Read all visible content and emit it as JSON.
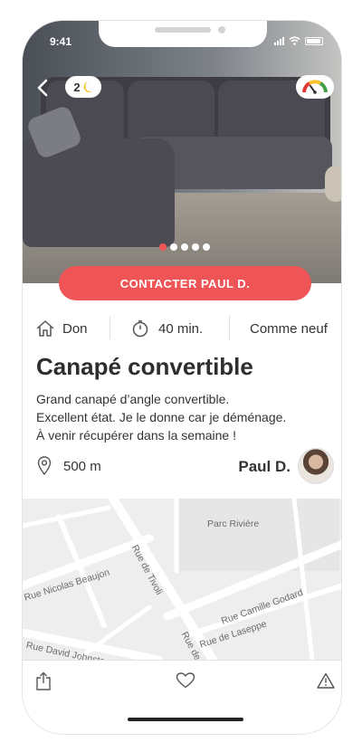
{
  "status_bar": {
    "time": "9:41"
  },
  "header": {
    "moon_count": "2"
  },
  "photo": {
    "slide_count": 5,
    "active_slide": 1
  },
  "contact_button": {
    "label": "CONTACTER PAUL D."
  },
  "info": {
    "type": "Don",
    "time": "40 min.",
    "condition": "Comme neuf"
  },
  "listing": {
    "title": "Canapé convertible",
    "description": [
      "Grand canapé d’angle convertible.",
      "Excellent état. Je le donne car je déménage.",
      "À venir récupérer dans la semaine !"
    ]
  },
  "location": {
    "distance": "500 m",
    "seller_name": "Paul D."
  },
  "map": {
    "labels": [
      "Parc Rivière",
      "Rue Nicolas Beaujon",
      "Rue de Tivoli",
      "Rue Camille Godard",
      "Rue de Laseppe",
      "Rue David Johnston",
      "Rue de L"
    ]
  },
  "toolbar": {
    "icons": [
      "share-icon",
      "heart-icon",
      "warning-icon"
    ]
  },
  "colors": {
    "accent": "#ef5456",
    "dot_inactive": "#ffffff"
  }
}
